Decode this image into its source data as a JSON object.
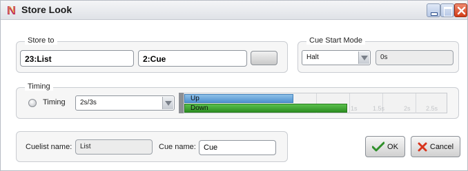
{
  "window": {
    "title": "Store Look"
  },
  "store_to": {
    "label": "Store to",
    "cuelist_value": "23:List",
    "cue_value": "2:Cue"
  },
  "cue_start_mode": {
    "label": "Cue Start Mode",
    "mode_value": "Halt",
    "time_value": "0s"
  },
  "timing": {
    "label": "Timing",
    "radio_label": "Timing",
    "value": "2s/3s",
    "up_label": "Up",
    "down_label": "Down",
    "up_fraction": 0.415,
    "down_fraction": 0.62,
    "tick_labels": [
      "1s",
      "1.5s",
      "2s",
      "2.5s"
    ]
  },
  "names": {
    "cuelist_label": "Cuelist name:",
    "cuelist_value": "List",
    "cue_label": "Cue name:",
    "cue_value": "Cue"
  },
  "actions": {
    "ok_label": "OK",
    "cancel_label": "Cancel"
  },
  "colors": {
    "up_bar": "#5a9bd5",
    "down_bar": "#3ba02f",
    "close_button": "#d84a25"
  }
}
